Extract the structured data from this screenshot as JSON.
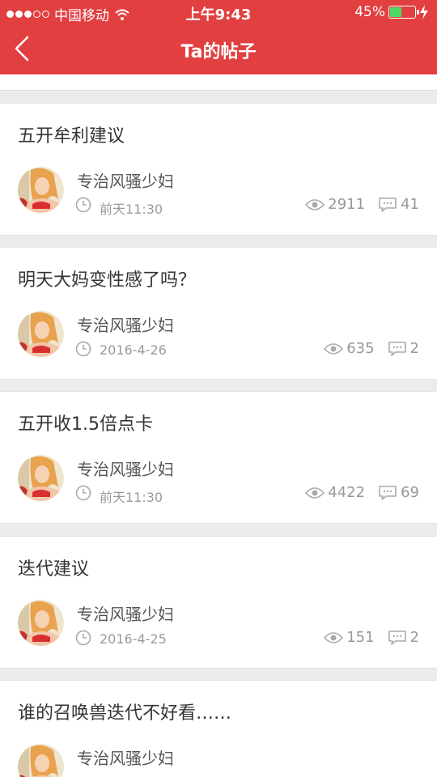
{
  "status_bar": {
    "carrier": "中国移动",
    "time": "上午9:43",
    "battery": "45%",
    "battery_level": 0.45
  },
  "nav": {
    "title": "Ta的帖子"
  },
  "posts": [
    {
      "title": "五开牟利建议",
      "author": "专治风骚少妇",
      "time": "前天11:30",
      "views": "2911",
      "comments": "41"
    },
    {
      "title": "明天大妈变性感了吗？",
      "author": "专治风骚少妇",
      "time": "2016-4-26",
      "views": "635",
      "comments": "2"
    },
    {
      "title": "五开收1.5倍点卡",
      "author": "专治风骚少妇",
      "time": "前天11:30",
      "views": "4422",
      "comments": "69"
    },
    {
      "title": "迭代建议",
      "author": "专治风骚少妇",
      "time": "2016-4-25",
      "views": "151",
      "comments": "2"
    },
    {
      "title": "谁的召唤兽迭代不好看……",
      "author": "专治风骚少妇",
      "time": "",
      "views": "",
      "comments": ""
    }
  ],
  "colors": {
    "header": "#e23f41",
    "battery_fill": "#4cd964"
  },
  "icons": [
    "back-arrow-icon",
    "wifi-icon",
    "charging-icon",
    "clock-icon",
    "eye-icon",
    "comment-icon"
  ]
}
